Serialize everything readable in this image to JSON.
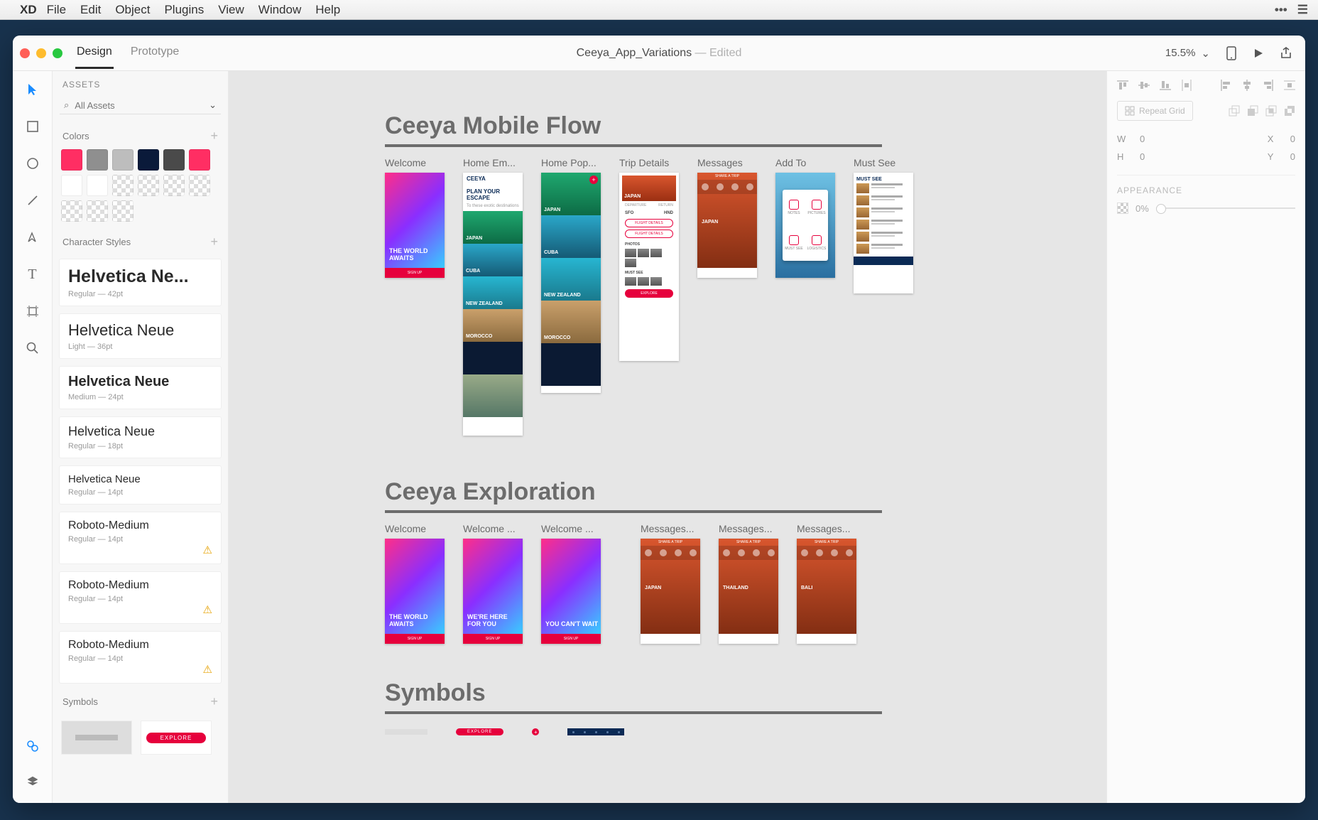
{
  "menubar": {
    "brand": "XD",
    "items": [
      "File",
      "Edit",
      "Object",
      "Plugins",
      "View",
      "Window",
      "Help"
    ]
  },
  "titlebar": {
    "modes": {
      "design": "Design",
      "prototype": "Prototype",
      "active": "Design"
    },
    "doc_name": "Ceeya_App_Variations",
    "doc_status": "Edited",
    "zoom": "15.5%"
  },
  "tools": [
    "select",
    "rectangle",
    "ellipse",
    "line",
    "pen",
    "text",
    "artboard",
    "zoom"
  ],
  "assets": {
    "header": "ASSETS",
    "filter_label": "All Assets",
    "colors_label": "Colors",
    "swatches": [
      "#ff2e63",
      "#8f8f8f",
      "#bdbdbd",
      "#0a1a3a",
      "#4a4a4a",
      "#ff2e63",
      "#ffffff",
      "#ffffff",
      "checker",
      "checker",
      "checker",
      "checker",
      "checker",
      "checker",
      "checker"
    ],
    "char_label": "Character Styles",
    "char_styles": [
      {
        "name": "Helvetica Ne...",
        "sub": "Regular — 42pt",
        "size": "25px",
        "weight": "600",
        "warn": false
      },
      {
        "name": "Helvetica Neue",
        "sub": "Light — 36pt",
        "size": "22px",
        "weight": "300",
        "warn": false
      },
      {
        "name": "Helvetica Neue",
        "sub": "Medium — 24pt",
        "size": "20px",
        "weight": "700",
        "warn": false
      },
      {
        "name": "Helvetica Neue",
        "sub": "Regular — 18pt",
        "size": "18px",
        "weight": "400",
        "warn": false
      },
      {
        "name": "Helvetica Neue",
        "sub": "Regular — 14pt",
        "size": "15px",
        "weight": "400",
        "warn": false
      },
      {
        "name": "Roboto-Medium",
        "sub": "Regular — 14pt",
        "size": "16px",
        "weight": "500",
        "warn": true
      },
      {
        "name": "Roboto-Medium",
        "sub": "Regular — 14pt",
        "size": "16px",
        "weight": "500",
        "warn": true
      },
      {
        "name": "Roboto-Medium",
        "sub": "Regular — 14pt",
        "size": "16px",
        "weight": "500",
        "warn": true
      }
    ],
    "symbols_label": "Symbols",
    "symbol_pill": "EXPLORE"
  },
  "canvas": {
    "section1": {
      "title": "Ceeya Mobile Flow",
      "artboards": [
        "Welcome",
        "Home Em...",
        "Home Pop...",
        "Trip Details",
        "Messages",
        "Add To",
        "Must See"
      ]
    },
    "section2": {
      "title": "Ceeya Exploration",
      "artboards": [
        "Welcome",
        "Welcome ...",
        "Welcome ...",
        "Messages...",
        "Messages...",
        "Messages..."
      ]
    },
    "section3": {
      "title": "Symbols"
    },
    "welcome_texts": [
      "THE WORLD AWAITS",
      "WE'RE HERE FOR YOU",
      "YOU CAN'T WAIT"
    ],
    "signup": "SIGN UP",
    "plan": "PLAN YOUR ESCAPE",
    "plan_sub": "To these exotic destinations",
    "logo": "CEEYA",
    "destinations": [
      "JAPAN",
      "CUBA",
      "NEW ZEALAND",
      "MOROCCO"
    ],
    "msg_labels": [
      "JAPAN",
      "THAILAND",
      "BALI"
    ],
    "trip": {
      "country": "JAPAN",
      "departure": "DEPARTURE",
      "return": "RETURN",
      "from": "SFO",
      "to": "HND",
      "btn1": "FLIGHT DETAILS",
      "btn2": "FLIGHT DETAILS",
      "photos": "PHOTOS",
      "mustsee": "MUST SEE",
      "explore": "EXPLORE"
    },
    "addto": [
      "NOTES",
      "PICTURES",
      "MUST SEE",
      "LOGISTICS"
    ],
    "must": {
      "title": "MUST SEE"
    },
    "share": "SHARE A TRIP",
    "explore_pill": "EXPLORE"
  },
  "inspector": {
    "repeat": "Repeat Grid",
    "w_label": "W",
    "w_val": "0",
    "x_label": "X",
    "x_val": "0",
    "h_label": "H",
    "h_val": "0",
    "y_label": "Y",
    "y_val": "0",
    "appearance": "APPEARANCE",
    "opacity": "0%"
  }
}
